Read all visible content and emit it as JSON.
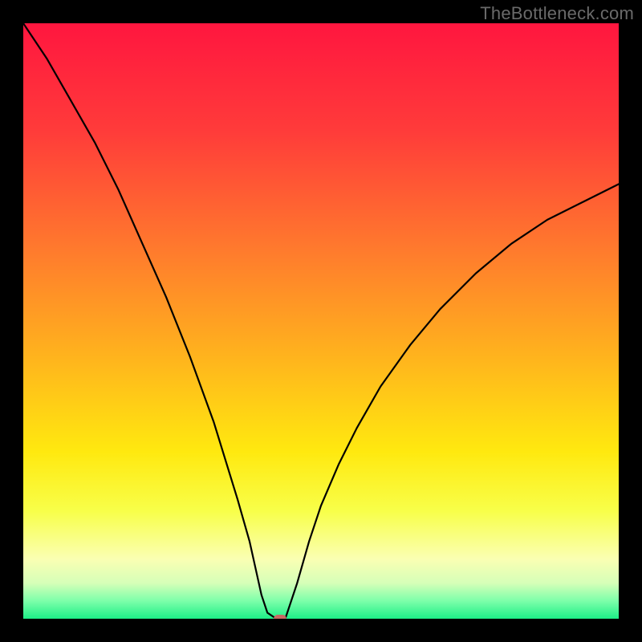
{
  "watermark": "TheBottleneck.com",
  "colors": {
    "frame": "#000000",
    "curve_stroke": "#000000",
    "marker_fill": "#c86a63",
    "gradient_stops": [
      {
        "offset": "0%",
        "color": "#ff163f"
      },
      {
        "offset": "18%",
        "color": "#ff3b3a"
      },
      {
        "offset": "38%",
        "color": "#ff7a2d"
      },
      {
        "offset": "55%",
        "color": "#ffb01e"
      },
      {
        "offset": "72%",
        "color": "#ffe90f"
      },
      {
        "offset": "82%",
        "color": "#f8ff4a"
      },
      {
        "offset": "90%",
        "color": "#faffb3"
      },
      {
        "offset": "94%",
        "color": "#d6ffb8"
      },
      {
        "offset": "97%",
        "color": "#7dffaa"
      },
      {
        "offset": "100%",
        "color": "#1def87"
      }
    ]
  },
  "chart_data": {
    "type": "line",
    "title": "",
    "xlabel": "",
    "ylabel": "",
    "xlim": [
      0,
      100
    ],
    "ylim": [
      0,
      100
    ],
    "note": "V-shaped bottleneck curve; y reaches 0 (optimal, green) near x≈42, rises steeply on both sides toward 100 (worst, red). Left branch starts at top-left corner (x=0, y=100); right branch exits right edge near y≈73.",
    "series": [
      {
        "name": "left-branch",
        "x": [
          0,
          4,
          8,
          12,
          16,
          20,
          24,
          28,
          32,
          36,
          38,
          40,
          41,
          42.5
        ],
        "y": [
          100,
          94,
          87,
          80,
          72,
          63,
          54,
          44,
          33,
          20,
          13,
          4,
          1,
          0
        ]
      },
      {
        "name": "right-branch",
        "x": [
          44,
          46,
          48,
          50,
          53,
          56,
          60,
          65,
          70,
          76,
          82,
          88,
          94,
          100
        ],
        "y": [
          0,
          6,
          13,
          19,
          26,
          32,
          39,
          46,
          52,
          58,
          63,
          67,
          70,
          73
        ]
      }
    ],
    "marker": {
      "x": 43.1,
      "y": 0,
      "label": "optimal-point"
    }
  }
}
